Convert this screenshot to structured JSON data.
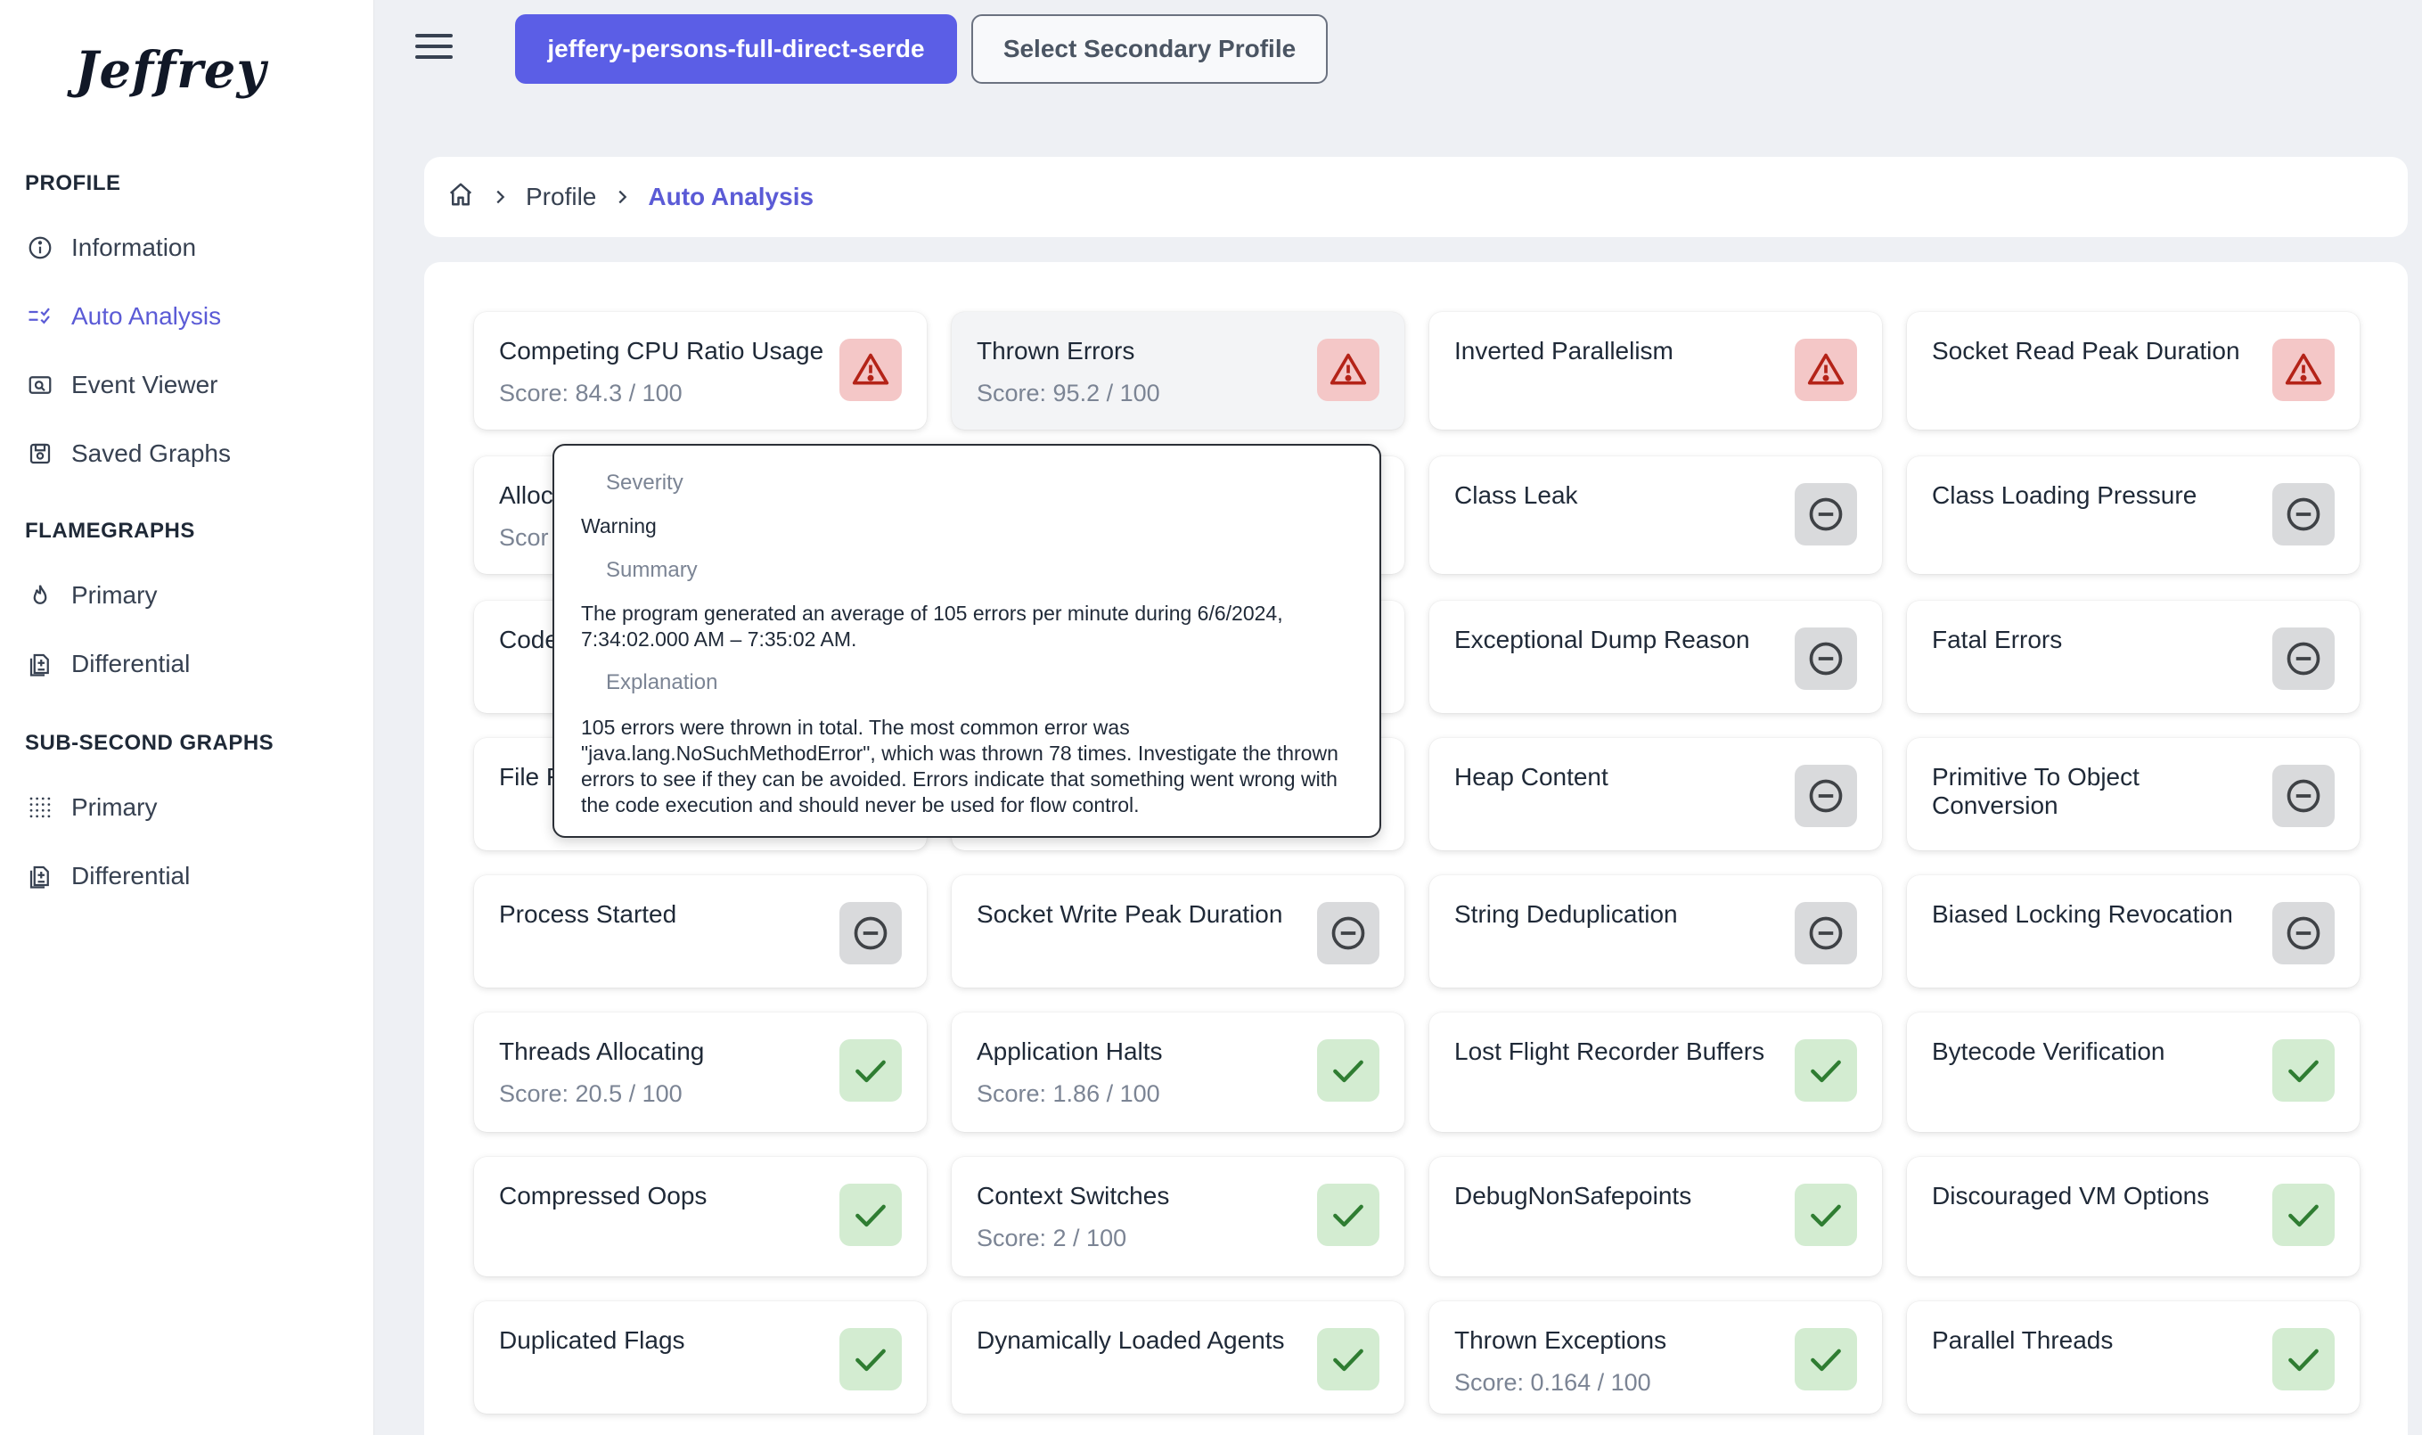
{
  "app": {
    "logo": "Jeffrey"
  },
  "sidebar": {
    "sections": [
      {
        "label": "PROFILE",
        "items": [
          {
            "label": "Information",
            "icon": "info-circle-icon",
            "active": false
          },
          {
            "label": "Auto Analysis",
            "icon": "checklist-icon",
            "active": true
          },
          {
            "label": "Event Viewer",
            "icon": "search-image-icon",
            "active": false
          },
          {
            "label": "Saved Graphs",
            "icon": "save-icon",
            "active": false
          }
        ]
      },
      {
        "label": "FLAMEGRAPHS",
        "items": [
          {
            "label": "Primary",
            "icon": "fire-icon",
            "active": false
          },
          {
            "label": "Differential",
            "icon": "file-diff-icon",
            "active": false
          }
        ]
      },
      {
        "label": "SUB-SECOND GRAPHS",
        "items": [
          {
            "label": "Primary",
            "icon": "grid-dots-icon",
            "active": false
          },
          {
            "label": "Differential",
            "icon": "file-diff-icon",
            "active": false
          }
        ]
      }
    ]
  },
  "topbar": {
    "primary_profile": "jeffery-persons-full-direct-serde",
    "secondary_profile": "Select Secondary Profile"
  },
  "breadcrumb": {
    "items": [
      "Profile",
      "Auto Analysis"
    ]
  },
  "colors": {
    "accent": "#5b5ee6",
    "warning_bg": "#f4c7c7",
    "warning_fg": "#b42318",
    "neutral_bg": "#d9dadc",
    "neutral_fg": "#3f4246",
    "ok_bg": "#d3ecd1",
    "ok_fg": "#2f7d32"
  },
  "cards": [
    {
      "title": "Competing CPU Ratio Usage",
      "score": "Score: 84.3 / 100",
      "status": "warning"
    },
    {
      "title": "Thrown Errors",
      "score": "Score: 95.2 / 100",
      "status": "warning"
    },
    {
      "title": "Inverted Parallelism",
      "score": "",
      "status": "warning"
    },
    {
      "title": "Socket Read Peak Duration",
      "score": "",
      "status": "warning"
    },
    {
      "title": "Alloc",
      "score": "Scor",
      "status": "neutral"
    },
    {
      "title": "",
      "score": "",
      "status": "neutral"
    },
    {
      "title": "Class Leak",
      "score": "",
      "status": "neutral"
    },
    {
      "title": "Class Loading Pressure",
      "score": "",
      "status": "neutral"
    },
    {
      "title": "Code",
      "score": "",
      "status": "neutral"
    },
    {
      "title": "",
      "score": "",
      "status": "neutral"
    },
    {
      "title": "Exceptional Dump Reason",
      "score": "",
      "status": "neutral"
    },
    {
      "title": "Fatal Errors",
      "score": "",
      "status": "neutral"
    },
    {
      "title": "File F",
      "score": "",
      "status": "neutral"
    },
    {
      "title": "",
      "score": "",
      "status": "neutral"
    },
    {
      "title": "Heap Content",
      "score": "",
      "status": "neutral"
    },
    {
      "title": "Primitive To Object Conversion",
      "score": "",
      "status": "neutral"
    },
    {
      "title": "Process Started",
      "score": "",
      "status": "neutral"
    },
    {
      "title": "Socket Write Peak Duration",
      "score": "",
      "status": "neutral"
    },
    {
      "title": "String Deduplication",
      "score": "",
      "status": "neutral"
    },
    {
      "title": "Biased Locking Revocation",
      "score": "",
      "status": "neutral"
    },
    {
      "title": "Threads Allocating",
      "score": "Score: 20.5 / 100",
      "status": "ok"
    },
    {
      "title": "Application Halts",
      "score": "Score: 1.86 / 100",
      "status": "ok"
    },
    {
      "title": "Lost Flight Recorder Buffers",
      "score": "",
      "status": "ok"
    },
    {
      "title": "Bytecode Verification",
      "score": "",
      "status": "ok"
    },
    {
      "title": "Compressed Oops",
      "score": "",
      "status": "ok"
    },
    {
      "title": "Context Switches",
      "score": "Score: 2 / 100",
      "status": "ok"
    },
    {
      "title": "DebugNonSafepoints",
      "score": "",
      "status": "ok"
    },
    {
      "title": "Discouraged VM Options",
      "score": "",
      "status": "ok"
    },
    {
      "title": "Duplicated Flags",
      "score": "",
      "status": "ok"
    },
    {
      "title": "Dynamically Loaded Agents",
      "score": "",
      "status": "ok"
    },
    {
      "title": "Thrown Exceptions",
      "score": "Score: 0.164 / 100",
      "status": "ok"
    },
    {
      "title": "Parallel Threads",
      "score": "",
      "status": "ok"
    }
  ],
  "tooltip": {
    "severity_label": "Severity",
    "severity_value": "Warning",
    "summary_label": "Summary",
    "summary_value": "The program generated an average of 105 errors per minute during 6/6/2024, 7:34:02.000 AM – 7:35:02 AM.",
    "explanation_label": "Explanation",
    "explanation_value": "105 errors were thrown in total. The most common error was \"java.lang.NoSuchMethodError\", which was thrown 78 times. Investigate the thrown errors to see if they can be avoided. Errors indicate that something went wrong with the code execution and should never be used for flow control."
  }
}
